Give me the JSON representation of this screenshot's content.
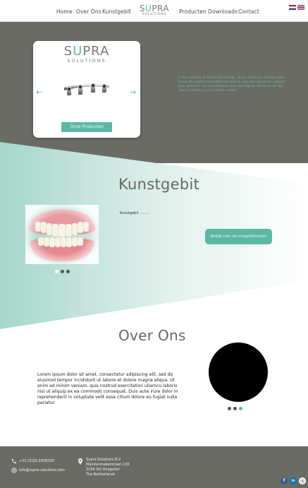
{
  "nav": {
    "left": [
      "Home",
      "Over Ons",
      "Kunstgebit"
    ],
    "right": [
      "Producten",
      "Downloads",
      "Contact"
    ]
  },
  "logo": {
    "main_pre": "S",
    "main_u": "U",
    "main_post": "PRA",
    "sub": "SOLUTIONS"
  },
  "hero": {
    "button": "Onze Producten",
    "prev_arrow": "←",
    "next_arrow": "→",
    "text": "In the century of dental technology, Supra Solutions has the goal to set the highest possible standard in suprastructures to support your practice. For conventional, but also digital, dentures we are able to deliver your products needs!"
  },
  "kunstgebit": {
    "title": "Kunstgebit",
    "text": "Kunstgebit .........",
    "button": "Bekijk hier de mogelijkheden"
  },
  "over_ons": {
    "title": "Over Ons",
    "text": "Lorem ipsum dolor sit amet, consectetur adipiscing elit, sed do eiusmod tempor incididunt ut labore et dolore magna aliqua. Ut enim ad minim veniam, quis nostrud exercitation ullamco laboris nisi ut aliquip ex ea commodo consequat. Duis aute irure dolor in reprehenderit in voluptate velit esse cillum dolore eu fugiat nulla pariatur."
  },
  "footer": {
    "phone": "+31 (0)10-2939230",
    "email": "info@supra-solutions.com",
    "address": [
      "Supra Solutions B.V.",
      "Mandenmakerstraat 130",
      "3194 DG Hoogvliet",
      "The Netherlands"
    ],
    "social": {
      "facebook": "f",
      "linkedin": "in",
      "instagram": "◎"
    }
  },
  "colors": {
    "accent": "#5cb8a5",
    "dark": "#6b6b66",
    "text": "#666666"
  }
}
